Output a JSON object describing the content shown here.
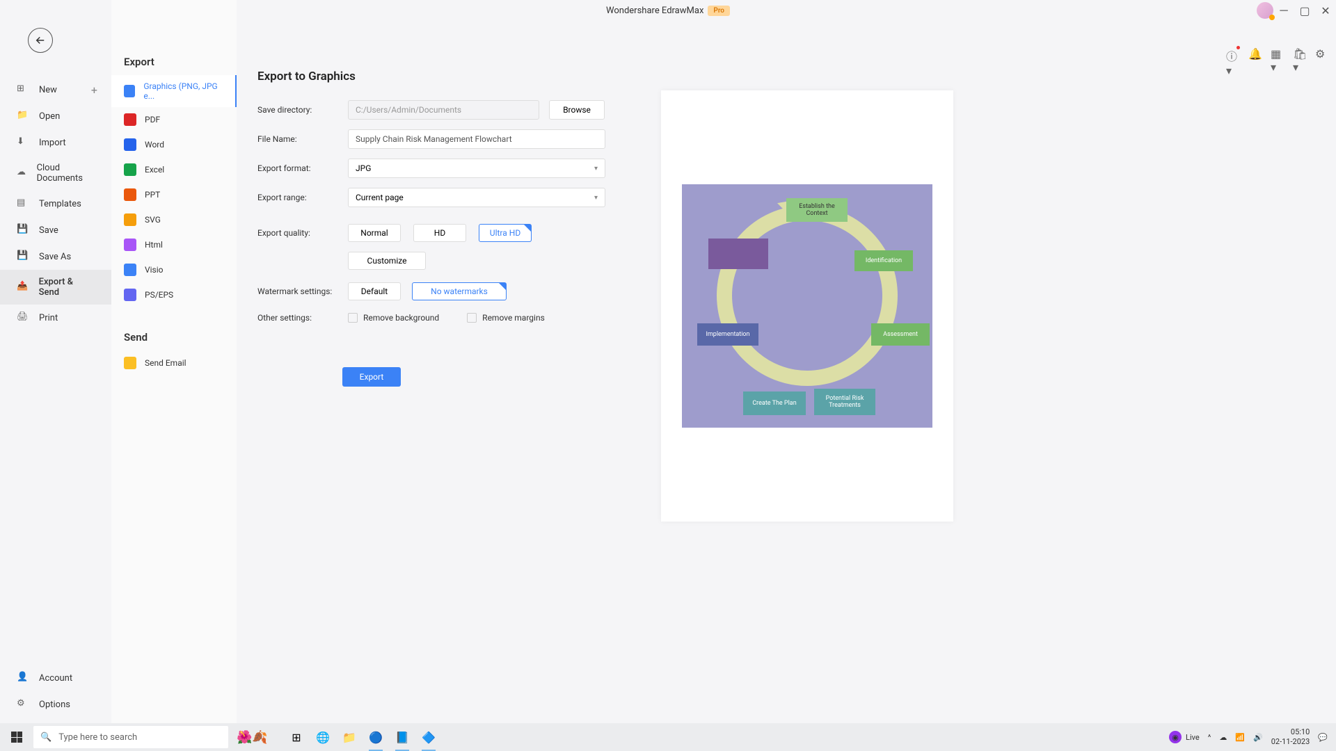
{
  "titlebar": {
    "app_name": "Wondershare EdrawMax",
    "badge": "Pro"
  },
  "sidebar": {
    "items": [
      {
        "label": "New",
        "has_plus": true
      },
      {
        "label": "Open"
      },
      {
        "label": "Import"
      },
      {
        "label": "Cloud Documents"
      },
      {
        "label": "Templates"
      },
      {
        "label": "Save"
      },
      {
        "label": "Save As"
      },
      {
        "label": "Export & Send"
      },
      {
        "label": "Print"
      }
    ],
    "bottom": [
      {
        "label": "Account"
      },
      {
        "label": "Options"
      }
    ]
  },
  "mid": {
    "export_title": "Export",
    "export_items": [
      {
        "label": "Graphics (PNG, JPG e..."
      },
      {
        "label": "PDF"
      },
      {
        "label": "Word"
      },
      {
        "label": "Excel"
      },
      {
        "label": "PPT"
      },
      {
        "label": "SVG"
      },
      {
        "label": "Html"
      },
      {
        "label": "Visio"
      },
      {
        "label": "PS/EPS"
      }
    ],
    "send_title": "Send",
    "send_items": [
      {
        "label": "Send Email"
      }
    ]
  },
  "main": {
    "title": "Export to Graphics",
    "labels": {
      "save_dir": "Save directory:",
      "file_name": "File Name:",
      "format": "Export format:",
      "range": "Export range:",
      "quality": "Export quality:",
      "watermark": "Watermark settings:",
      "other": "Other settings:"
    },
    "values": {
      "save_dir": "C:/Users/Admin/Documents",
      "file_name": "Supply Chain Risk Management Flowchart",
      "format": "JPG",
      "range": "Current page"
    },
    "browse": "Browse",
    "quality": {
      "normal": "Normal",
      "hd": "HD",
      "ultra": "Ultra HD",
      "customize": "Customize"
    },
    "watermark": {
      "default": "Default",
      "none": "No watermarks"
    },
    "checkboxes": {
      "remove_bg": "Remove background",
      "remove_margins": "Remove margins"
    },
    "export_btn": "Export"
  },
  "preview": {
    "establish": "Establish the Context",
    "identification": "Identification",
    "assessment": "Assessment",
    "implementation": "Implementation",
    "create_plan": "Create The Plan",
    "treatments": "Potential Risk Treatments"
  },
  "taskbar": {
    "search_placeholder": "Type here to search",
    "live": "Live",
    "time": "05:10",
    "date": "02-11-2023"
  }
}
